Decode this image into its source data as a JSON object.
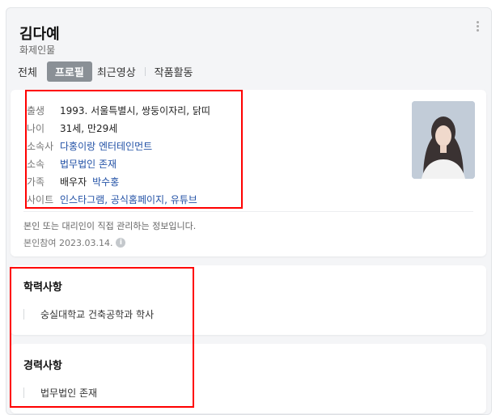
{
  "header": {
    "name": "김다예",
    "category": "화제인물"
  },
  "tabs": [
    {
      "label": "전체"
    },
    {
      "label": "프로필",
      "active": true
    },
    {
      "label": "최근영상"
    },
    {
      "label": "작품활동"
    }
  ],
  "profile": {
    "rows": [
      {
        "label": "출생",
        "value": "1993. 서울특별시, 쌍둥이자리, 닭띠"
      },
      {
        "label": "나이",
        "value": "31세, 만29세"
      },
      {
        "label": "소속사",
        "value": "다홍이랑 엔터테인먼트"
      },
      {
        "label": "소속",
        "value": "법무법인 존재"
      },
      {
        "label": "가족",
        "prefix": "배우자",
        "value": "박수홍"
      },
      {
        "label": "사이트",
        "value": "인스타그램, 공식홈페이지, 유튜브"
      }
    ],
    "note": "본인 또는 대리인이 직접 관리하는 정보입니다.",
    "joined": "본인참여 2023.03.14."
  },
  "education": {
    "title": "학력사항",
    "items": [
      "숭실대학교 건축공학과 학사"
    ]
  },
  "career": {
    "title": "경력사항",
    "items": [
      "법무법인 존재"
    ]
  },
  "colors": {
    "link": "#2352a6",
    "annotation": "#ff0000",
    "active_tab": "#8a9096"
  },
  "icons": {
    "more": "more-vertical-icon",
    "info": "info-icon"
  }
}
